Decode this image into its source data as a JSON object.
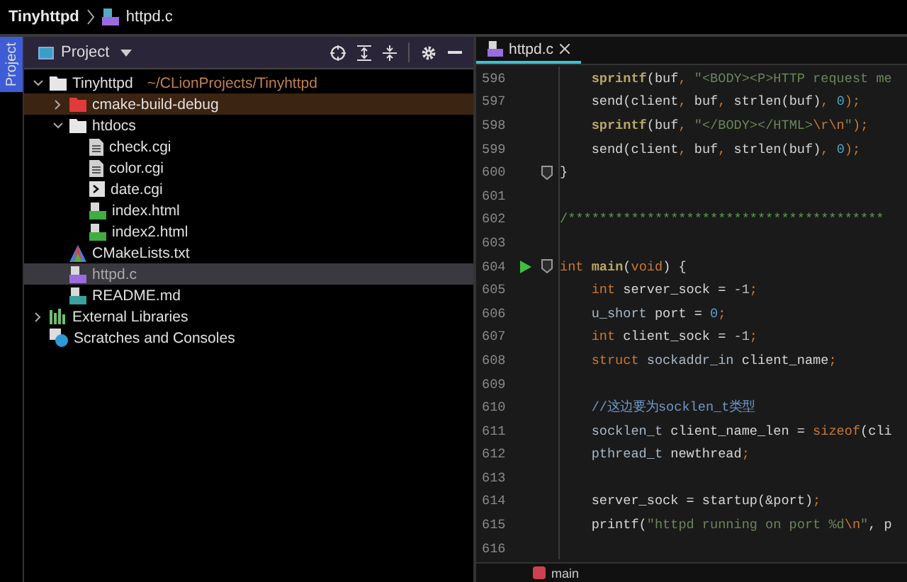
{
  "breadcrumb": {
    "project": "Tinyhttpd",
    "file": "httpd.c"
  },
  "side_tab": {
    "label": "Project",
    "selected": true
  },
  "project_panel": {
    "title": "Project",
    "tree": [
      {
        "name": "Tinyhttpd",
        "hint": "~/CLionProjects/Tinyhttpd",
        "kind": "folder",
        "expanded": true,
        "selected": false,
        "excluded": false,
        "children": [
          {
            "name": "cmake-build-debug",
            "kind": "folder",
            "expanded": false,
            "selected": false,
            "excluded": true
          },
          {
            "name": "htdocs",
            "kind": "folder",
            "expanded": true,
            "selected": false,
            "excluded": false,
            "children": [
              {
                "name": "check.cgi",
                "kind": "file",
                "selected": false,
                "excluded": false
              },
              {
                "name": "color.cgi",
                "kind": "file",
                "selected": false,
                "excluded": false
              },
              {
                "name": "date.cgi",
                "kind": "script",
                "selected": false,
                "excluded": false
              },
              {
                "name": "index.html",
                "kind": "html",
                "selected": false,
                "excluded": false
              },
              {
                "name": "index2.html",
                "kind": "html",
                "selected": false,
                "excluded": false
              }
            ]
          },
          {
            "name": "CMakeLists.txt",
            "kind": "cmake",
            "selected": false,
            "excluded": false
          },
          {
            "name": "httpd.c",
            "kind": "c",
            "selected": true,
            "excluded": false
          },
          {
            "name": "README.md",
            "kind": "md",
            "selected": false,
            "excluded": false
          }
        ]
      },
      {
        "name": "External Libraries",
        "kind": "libraries",
        "expanded": false,
        "selected": false,
        "excluded": false
      },
      {
        "name": "Scratches and Consoles",
        "kind": "scratches",
        "selected": false,
        "excluded": false
      }
    ]
  },
  "editor": {
    "tabs": [
      {
        "label": "httpd.c",
        "selected": true
      }
    ],
    "lines": [
      {
        "number": "596",
        "parts": [
          {
            "text": "    sprintf",
            "kind": "fn"
          },
          {
            "text": "(buf",
            "kind": "plain"
          },
          {
            "text": ", ",
            "kind": "op"
          },
          {
            "text": "\"<BODY><P>HTTP request me",
            "kind": "str"
          }
        ]
      },
      {
        "number": "597",
        "parts": [
          {
            "text": "    send(client",
            "kind": "plain"
          },
          {
            "text": ", ",
            "kind": "op"
          },
          {
            "text": "buf",
            "kind": "plain"
          },
          {
            "text": ", ",
            "kind": "op"
          },
          {
            "text": "strlen(buf)",
            "kind": "plain"
          },
          {
            "text": ", ",
            "kind": "op"
          },
          {
            "text": "0",
            "kind": "num"
          },
          {
            "text": ");",
            "kind": "op"
          }
        ]
      },
      {
        "number": "598",
        "parts": [
          {
            "text": "    sprintf",
            "kind": "fn"
          },
          {
            "text": "(buf",
            "kind": "plain"
          },
          {
            "text": ", ",
            "kind": "op"
          },
          {
            "text": "\"</BODY></HTML>",
            "kind": "str"
          },
          {
            "text": "\\r\\n",
            "kind": "esc"
          },
          {
            "text": "\"",
            "kind": "str"
          },
          {
            "text": ");",
            "kind": "op"
          }
        ]
      },
      {
        "number": "599",
        "parts": [
          {
            "text": "    send(client",
            "kind": "plain"
          },
          {
            "text": ", ",
            "kind": "op"
          },
          {
            "text": "buf",
            "kind": "plain"
          },
          {
            "text": ", ",
            "kind": "op"
          },
          {
            "text": "strlen(buf)",
            "kind": "plain"
          },
          {
            "text": ", ",
            "kind": "op"
          },
          {
            "text": "0",
            "kind": "num"
          },
          {
            "text": ");",
            "kind": "op"
          }
        ]
      },
      {
        "number": "600",
        "gutter": [
          {
            "kind": "fold"
          }
        ],
        "parts": [
          {
            "text": "}",
            "kind": "plain"
          }
        ]
      },
      {
        "number": "601"
      },
      {
        "number": "602",
        "parts": [
          {
            "text": "/****************************************",
            "kind": "doc"
          }
        ]
      },
      {
        "number": "603"
      },
      {
        "number": "604",
        "gutter": [
          {
            "kind": "run"
          },
          {
            "kind": "fold"
          }
        ],
        "parts": [
          {
            "text": "int ",
            "kind": "kw"
          },
          {
            "text": "main",
            "kind": "fn"
          },
          {
            "text": "(",
            "kind": "plain"
          },
          {
            "text": "void",
            "kind": "kw"
          },
          {
            "text": ") {",
            "kind": "plain"
          }
        ]
      },
      {
        "number": "605",
        "parts": [
          {
            "text": "    int ",
            "kind": "kw"
          },
          {
            "text": "server_sock = ",
            "kind": "plain"
          },
          {
            "text": "-1",
            "kind": "neg"
          },
          {
            "text": ";",
            "kind": "op"
          }
        ]
      },
      {
        "number": "606",
        "parts": [
          {
            "text": "    u_short ",
            "kind": "type"
          },
          {
            "text": "port = ",
            "kind": "plain"
          },
          {
            "text": "0",
            "kind": "num"
          },
          {
            "text": ";",
            "kind": "op"
          }
        ]
      },
      {
        "number": "607",
        "parts": [
          {
            "text": "    int ",
            "kind": "kw"
          },
          {
            "text": "client_sock = ",
            "kind": "plain"
          },
          {
            "text": "-1",
            "kind": "neg"
          },
          {
            "text": ";",
            "kind": "op"
          }
        ]
      },
      {
        "number": "608",
        "parts": [
          {
            "text": "    struct ",
            "kind": "kw"
          },
          {
            "text": "sockaddr_in ",
            "kind": "type"
          },
          {
            "text": "client_name",
            "kind": "plain"
          },
          {
            "text": ";",
            "kind": "op"
          }
        ]
      },
      {
        "number": "609"
      },
      {
        "number": "610",
        "parts": [
          {
            "text": "    //这边要为socklen_t类型",
            "kind": "cmt"
          }
        ]
      },
      {
        "number": "611",
        "parts": [
          {
            "text": "    socklen_t ",
            "kind": "type"
          },
          {
            "text": "client_name_len = ",
            "kind": "plain"
          },
          {
            "text": "sizeof",
            "kind": "kw"
          },
          {
            "text": "(cli",
            "kind": "plain"
          }
        ]
      },
      {
        "number": "612",
        "parts": [
          {
            "text": "    pthread_t ",
            "kind": "type"
          },
          {
            "text": "newthread",
            "kind": "plain"
          },
          {
            "text": ";",
            "kind": "op"
          }
        ]
      },
      {
        "number": "613"
      },
      {
        "number": "614",
        "parts": [
          {
            "text": "    server_sock = startup(&port)",
            "kind": "plain"
          },
          {
            "text": ";",
            "kind": "op"
          }
        ]
      },
      {
        "number": "615",
        "parts": [
          {
            "text": "    printf(",
            "kind": "plain"
          },
          {
            "text": "\"httpd running on port %d",
            "kind": "str"
          },
          {
            "text": "\\n",
            "kind": "esc"
          },
          {
            "text": "\"",
            "kind": "str"
          },
          {
            "text": ", p",
            "kind": "plain"
          }
        ]
      },
      {
        "number": "616"
      }
    ],
    "footer": "main"
  }
}
